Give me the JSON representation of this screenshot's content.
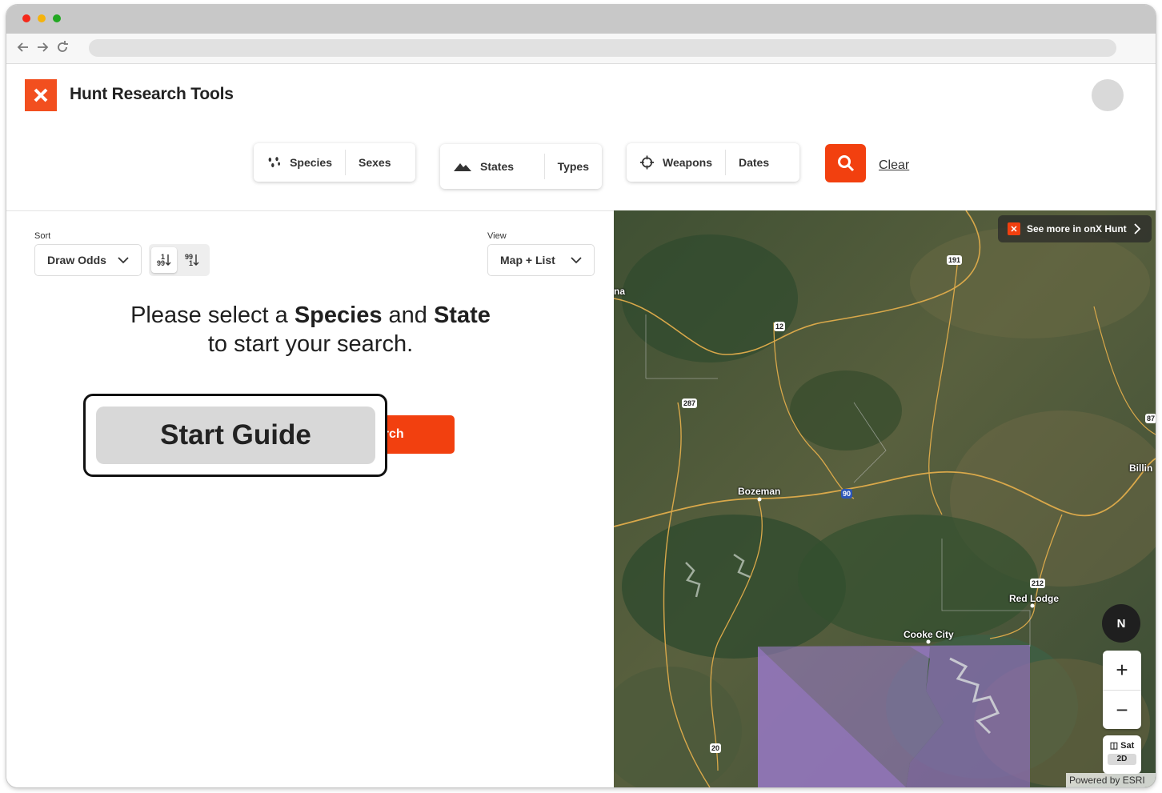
{
  "app": {
    "title": "Hunt Research Tools"
  },
  "filters": {
    "group1": {
      "species": "Species",
      "sexes": "Sexes"
    },
    "group2": {
      "states": "States",
      "types": "Types"
    },
    "group3": {
      "weapons": "Weapons",
      "dates": "Dates"
    },
    "clear_label": "Clear"
  },
  "sort": {
    "label": "Sort",
    "value": "Draw Odds",
    "asc_top": "1",
    "asc_bottom": "99",
    "desc_top": "99",
    "desc_bottom": "1"
  },
  "view": {
    "label": "View",
    "value": "Map + List"
  },
  "prompt": {
    "line1_pre": "Please select a ",
    "species": "Species",
    "line1_mid": " and ",
    "state": "State",
    "line2": "to start your search."
  },
  "search_button": "Search",
  "guide_button": "Start Guide",
  "map": {
    "banner": "See more in onX Hunt",
    "labels": {
      "bozeman": "Bozeman",
      "red_lodge": "Red Lodge",
      "cooke_city": "Cooke City",
      "billings": "Billin",
      "na": "na"
    },
    "shields": {
      "s191": "191",
      "s12": "12",
      "s287": "287",
      "s90": "90",
      "s212": "212",
      "s20": "20",
      "s87": "87"
    },
    "compass": "N",
    "zoom_in": "+",
    "zoom_out": "−",
    "sat_label": "Sat",
    "twod_label": "2D",
    "powered": "Powered by ESRI"
  },
  "colors": {
    "brand": "#f24f1f",
    "accent_button": "#f2400f"
  }
}
